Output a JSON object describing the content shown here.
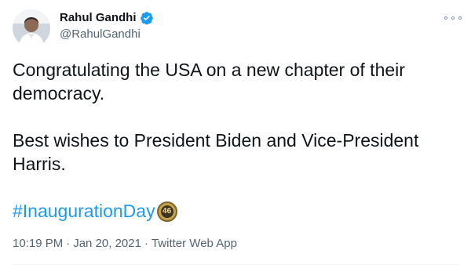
{
  "author": {
    "display_name": "Rahul Gandhi",
    "handle": "@RahulGandhi",
    "verified_icon": "verified-badge-icon",
    "verified_color": "#1d9bf0"
  },
  "menu": {
    "icon": "more-options-icon"
  },
  "tweet": {
    "paragraphs": [
      "Congratulating the USA on a new chapter of their democracy.",
      "Best wishes to President Biden and Vice-President Harris."
    ],
    "hashtag": "#InaugurationDay",
    "hashtag_color": "#1d9bf0",
    "emoji_icon": "inauguration-46-emoji-icon",
    "emoji_text": "46"
  },
  "meta": {
    "time": "10:19 PM",
    "separator": "·",
    "date": "Jan 20, 2021",
    "source": "Twitter Web App"
  }
}
